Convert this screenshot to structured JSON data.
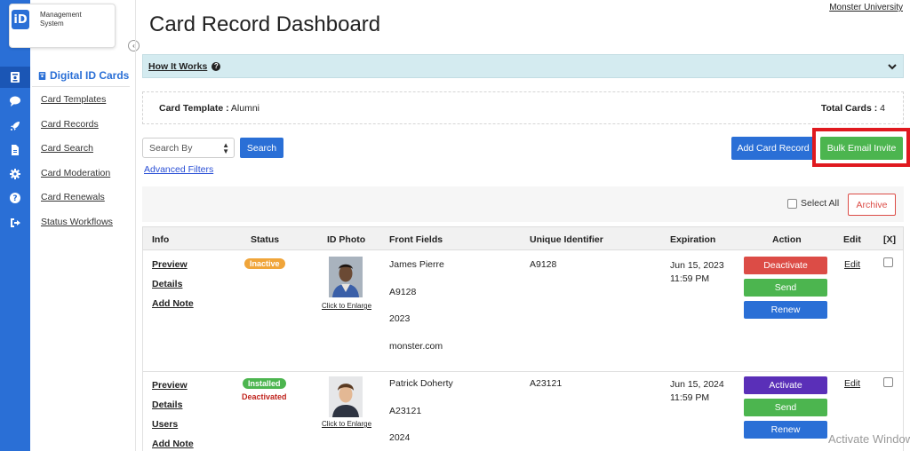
{
  "logo": {
    "mark": "iD",
    "line1": "Management",
    "line2": "System"
  },
  "rail_icons": [
    "id-card-icon",
    "chat-icon",
    "rocket-icon",
    "file-icon",
    "gear-icon",
    "help-icon",
    "logout-icon"
  ],
  "sidebar": {
    "heading": "Digital ID Cards",
    "items": [
      {
        "label": "Card Templates"
      },
      {
        "label": "Card Records"
      },
      {
        "label": "Card Search"
      },
      {
        "label": "Card Moderation"
      },
      {
        "label": "Card Renewals"
      },
      {
        "label": "Status Workflows"
      }
    ]
  },
  "header": {
    "title": "Card Record Dashboard",
    "org_link": "Monster University"
  },
  "how_it_works": {
    "label": "How It Works"
  },
  "template_info": {
    "template_label": "Card Template :",
    "template_value": "Alumni",
    "total_label": "Total Cards :",
    "total_value": "4"
  },
  "toolbar": {
    "search_by": "Search By",
    "search_button": "Search",
    "advanced_filters": "Advanced Filters",
    "add_card_record": "Add Card Record",
    "bulk_email_invite": "Bulk Email Invite",
    "select_all": "Select All",
    "archive": "Archive"
  },
  "table": {
    "columns": [
      "Info",
      "Status",
      "ID Photo",
      "Front Fields",
      "Unique Identifier",
      "Expiration",
      "Action",
      "Edit",
      "[X]"
    ],
    "rows": [
      {
        "info_links": [
          "Preview",
          "Details",
          "Add Note"
        ],
        "status": "Inactive",
        "status_sub": "",
        "enlarge": "Click to Enlarge",
        "front_fields": [
          "James Pierre",
          "A9128",
          "2023",
          "monster.com"
        ],
        "unique_id": "A9128",
        "exp_date": "Jun 15, 2023",
        "exp_time": "11:59 PM",
        "actions": [
          "Deactivate",
          "Send",
          "Renew"
        ],
        "edit": "Edit"
      },
      {
        "info_links": [
          "Preview",
          "Details",
          "Users",
          "Add Note"
        ],
        "status": "Installed",
        "status_sub": "Deactivated",
        "enlarge": "Click to Enlarge",
        "front_fields": [
          "Patrick Doherty",
          "A23121",
          "2024"
        ],
        "unique_id": "A23121",
        "exp_date": "Jun 15, 2024",
        "exp_time": "11:59 PM",
        "actions": [
          "Activate",
          "Send",
          "Renew"
        ],
        "edit": "Edit"
      }
    ]
  },
  "watermark": "Activate Windows",
  "colors": {
    "primary": "#2a6fd6",
    "success": "#4cb54f",
    "danger": "#dc4c46",
    "purple": "#5a2fb8",
    "highlight": "#e0191f"
  }
}
